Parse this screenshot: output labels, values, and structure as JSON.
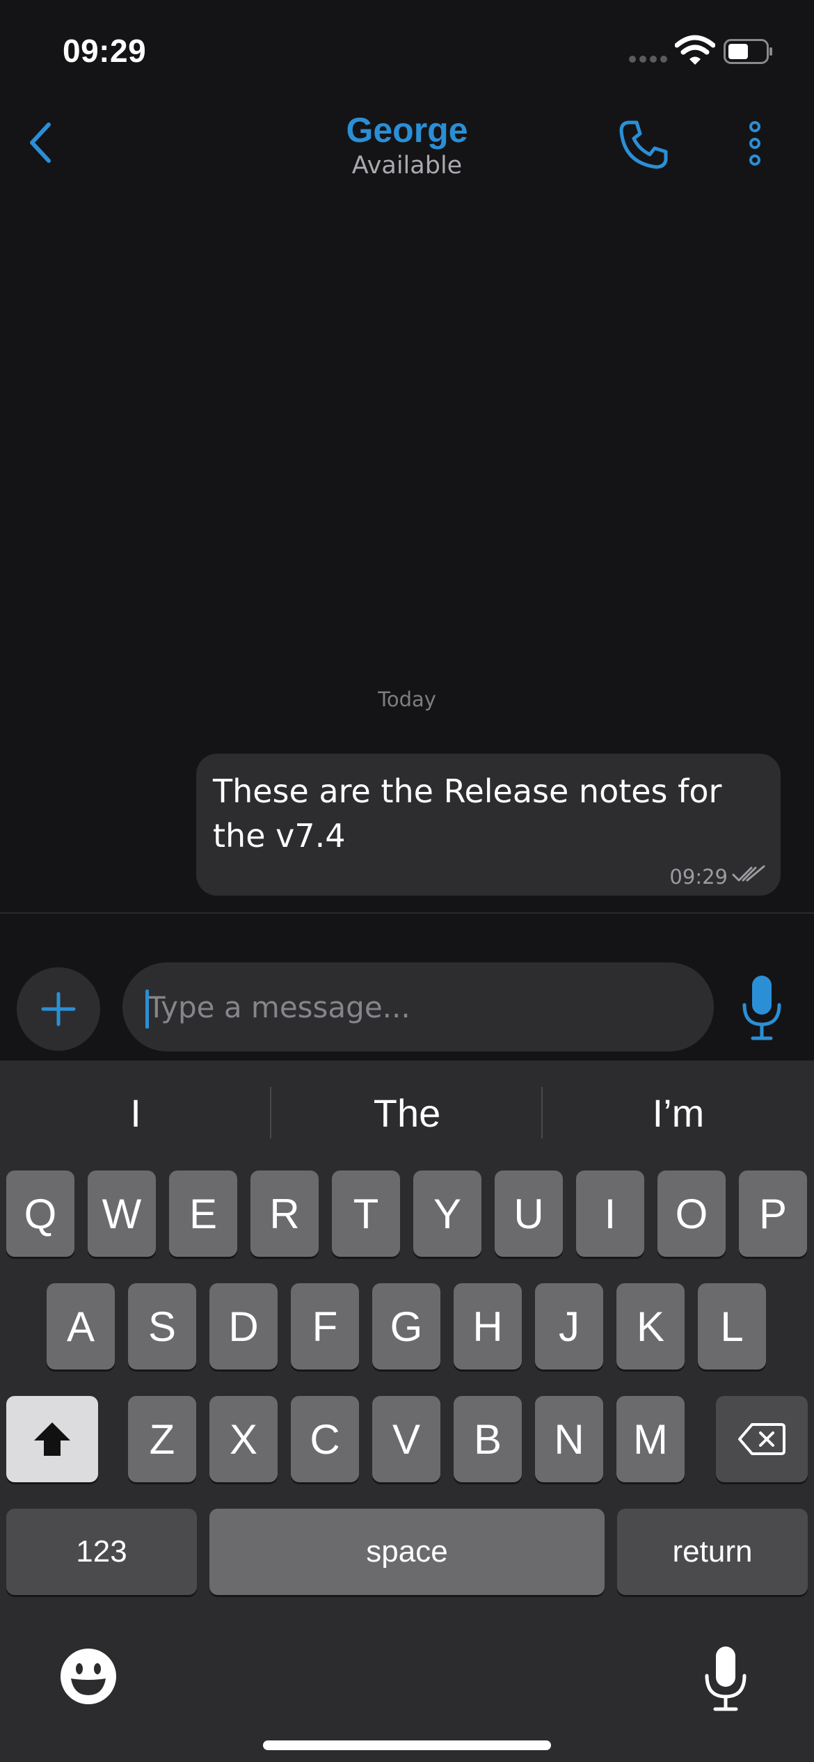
{
  "status_bar": {
    "time": "09:29",
    "icons": [
      "signal-dots-icon",
      "wifi-icon",
      "battery-icon"
    ]
  },
  "header": {
    "contact_name": "George",
    "contact_status": "Available",
    "icons": [
      "chevron-left-icon",
      "phone-icon",
      "more-vertical-icon"
    ]
  },
  "chat": {
    "date_divider": "Today",
    "messages": [
      {
        "text": "These are the Release notes for the v7.4",
        "time": "09:29",
        "status": "read"
      }
    ]
  },
  "composer": {
    "placeholder": "Type a message...",
    "value": "",
    "icons": [
      "plus-icon",
      "microphone-icon"
    ]
  },
  "keyboard": {
    "suggestions": [
      "I",
      "The",
      "I’m"
    ],
    "row1": [
      "Q",
      "W",
      "E",
      "R",
      "T",
      "Y",
      "U",
      "I",
      "O",
      "P"
    ],
    "row2": [
      "A",
      "S",
      "D",
      "F",
      "G",
      "H",
      "J",
      "K",
      "L"
    ],
    "row3": [
      "Z",
      "X",
      "C",
      "V",
      "B",
      "N",
      "M"
    ],
    "numbers_label": "123",
    "space_label": "space",
    "return_label": "return",
    "icons": [
      "shift-icon",
      "delete-icon",
      "emoji-icon",
      "dictation-icon"
    ]
  },
  "colors": {
    "accent": "#2b8fd6",
    "background": "#141416",
    "bubble": "#2d2d30",
    "keyboard": "#2c2c2e",
    "key": "#6b6b6e"
  }
}
